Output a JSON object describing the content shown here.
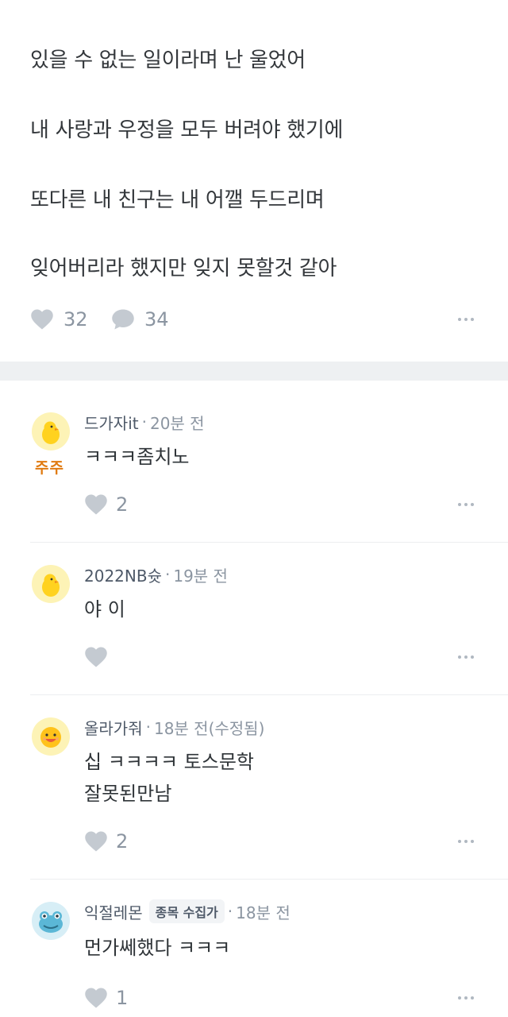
{
  "post": {
    "lines": [
      "있을 수 없는 일이라며 난 울었어",
      "내 사랑과 우정을 모두 버려야 했기에",
      "또다른 내 친구는 내 어깰 두드리며",
      "잊어버리라 했지만 잊지 못할것 같아"
    ],
    "likes": "32",
    "comments": "34"
  },
  "comments": [
    {
      "nickname": "드가자it",
      "time": "20분 전",
      "badge": "주주",
      "text": [
        "ㅋㅋㅋ좀치노"
      ],
      "likes": "2",
      "avatar": "chick-avatar"
    },
    {
      "nickname": "2022NB슛",
      "time": "19분 전",
      "text": [
        "야 이"
      ],
      "likes": "",
      "avatar": "chick-avatar"
    },
    {
      "nickname": "올라가줘",
      "time": "18분 전(수정됨)",
      "text": [
        "십 ㅋㅋㅋㅋ 토스문학",
        "잘못된만남"
      ],
      "likes": "2",
      "avatar": "smiley-avatar"
    },
    {
      "nickname": "익절레몬",
      "tag": "종목 수집가",
      "time": "18분 전",
      "text": [
        "먼가쎄했다 ㅋㅋㅋ"
      ],
      "likes": "1",
      "avatar": "frog-avatar"
    }
  ],
  "colors": {
    "accent_badge": "#e07a10",
    "icon_gray": "#c4cad1",
    "text_gray": "#8b95a1",
    "divider": "#eef0f2"
  }
}
